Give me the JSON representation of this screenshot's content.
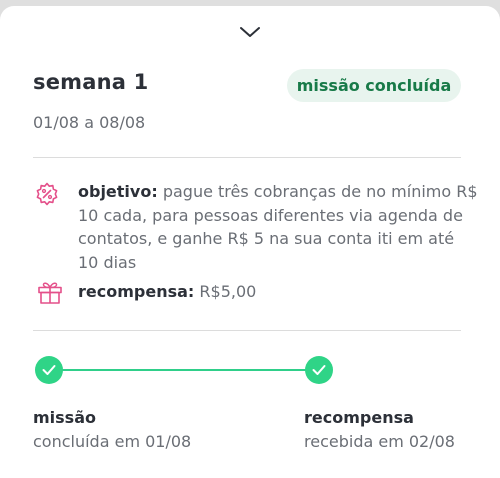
{
  "header": {
    "collapse_icon": "chevron-down-icon"
  },
  "mission": {
    "title": "semana 1",
    "status": "missão concluída",
    "date_range": "01/08 a 08/08"
  },
  "details": {
    "objective_icon": "discount-badge-icon",
    "objective_label": "objetivo:",
    "objective_text": "pague três cobranças de no mínimo R$ 10 cada, para pessoas diferentes via agenda de contatos, e ganhe R$ 5 na sua conta iti em até 10 dias",
    "reward_icon": "gift-icon",
    "reward_label": "recompensa:",
    "reward_value": "R$5,00"
  },
  "progress": {
    "steps": [
      {
        "title": "missão",
        "subtitle": "concluída em 01/08",
        "completed": true
      },
      {
        "title": "recompensa",
        "subtitle": "recebida em 02/08",
        "completed": true
      }
    ]
  },
  "colors": {
    "accent_green": "#2fd487",
    "badge_bg": "#e8f4ee",
    "badge_text": "#187a48",
    "icon_pink": "#e4508a"
  }
}
